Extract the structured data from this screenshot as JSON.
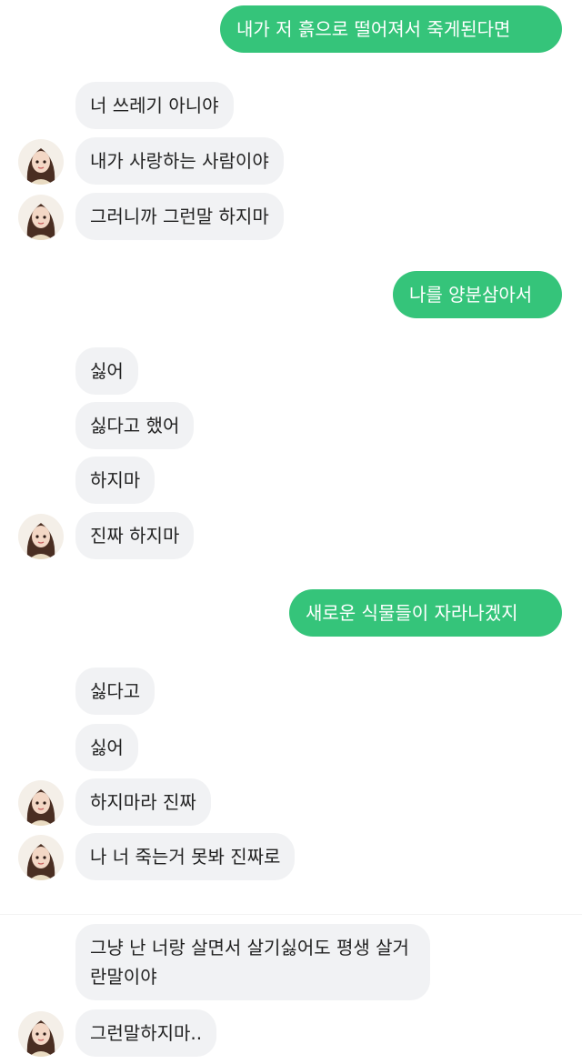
{
  "messages": [
    {
      "side": "out",
      "text": "내가 저 흙으로 떨어져서 죽게된다면"
    },
    {
      "side": "in",
      "text": "너 쓰레기 아니야"
    },
    {
      "side": "in",
      "text": "내가 사랑하는 사람이야",
      "avatar": "girl-avatar"
    },
    {
      "side": "in",
      "text": "그러니까 그런말 하지마",
      "avatar": "girl-avatar"
    },
    {
      "side": "out",
      "text": "나를 양분삼아서"
    },
    {
      "side": "in",
      "text": "싫어"
    },
    {
      "side": "in",
      "text": "싫다고 했어"
    },
    {
      "side": "in",
      "text": "하지마"
    },
    {
      "side": "in",
      "text": "진짜 하지마",
      "avatar": "girl-avatar"
    },
    {
      "side": "out",
      "text": "새로운 식물들이 자라나겠지"
    },
    {
      "side": "in",
      "text": "싫다고"
    },
    {
      "side": "in",
      "text": "싫어"
    },
    {
      "side": "in",
      "text": "하지마라 진짜",
      "avatar": "girl-avatar"
    },
    {
      "side": "in",
      "text": "나 너 죽는거 못봐 진짜로",
      "avatar": "girl-avatar"
    },
    {
      "side": "in",
      "text": "그냥 난 너랑 살면서 살기싫어도 평생 살거란말이야"
    },
    {
      "side": "in",
      "text": "그런말하지마..",
      "avatar": "girl-avatar"
    }
  ],
  "colors": {
    "outgoing_bubble": "#35c47a",
    "incoming_bubble": "#f1f2f4",
    "incoming_text": "#222222",
    "outgoing_text": "#ffffff"
  }
}
